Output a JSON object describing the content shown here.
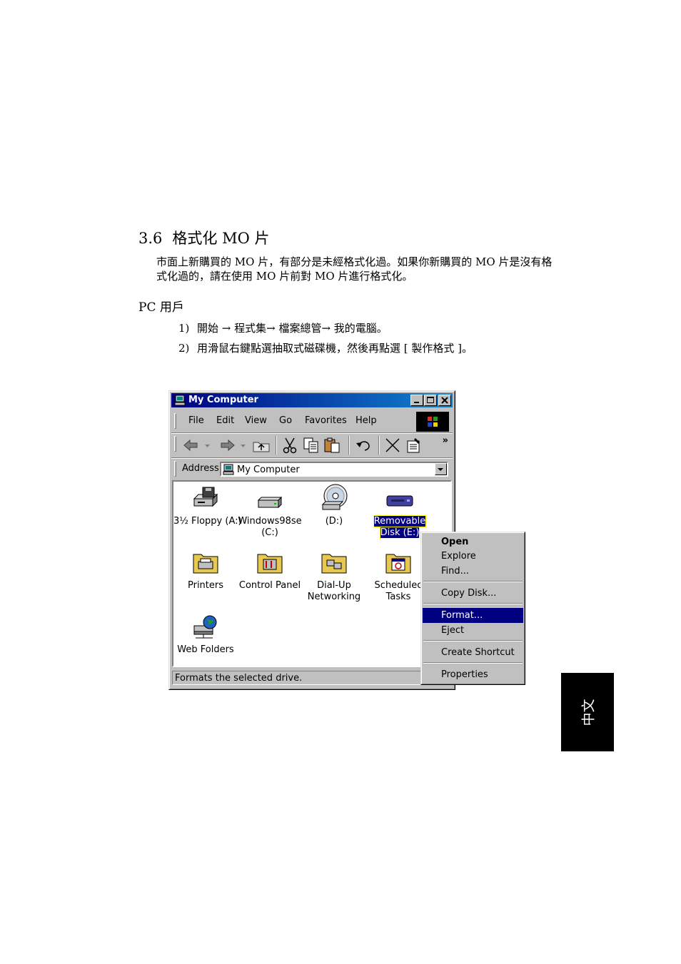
{
  "heading": {
    "number": "3.6",
    "title": "格式化 MO 片"
  },
  "intro": "市面上新購買的 MO 片，有部分是未經格式化過。如果你新購買的 MO 片是沒有格式化過的，請在使用 MO 片前對 MO 片進行格式化。",
  "subheading": "PC 用戶",
  "steps": [
    {
      "num": "1)",
      "text": "開始 → 程式集→ 檔案總管→ 我的電腦。"
    },
    {
      "num": "2)",
      "text": "用滑鼠右鍵點選抽取式磁碟機，然後再點選 [ 製作格式 ]。"
    }
  ],
  "side_tab": "中文",
  "window": {
    "title": "My Computer",
    "menu": [
      "File",
      "Edit",
      "View",
      "Go",
      "Favorites",
      "Help"
    ],
    "address_label": "Address",
    "address_value": "My Computer",
    "icons": [
      {
        "label": "3½ Floppy (A:)",
        "icon": "floppy-drive-icon"
      },
      {
        "label": "Windows98se",
        "label2": "(C:)",
        "icon": "hard-drive-icon"
      },
      {
        "label": "(D:)",
        "icon": "cd-drive-icon"
      },
      {
        "label": "Removable",
        "label2": "Disk (E:)",
        "icon": "removable-disk-icon",
        "selected": true
      },
      {
        "label": "Printers",
        "icon": "printers-folder-icon"
      },
      {
        "label": "Control Panel",
        "icon": "control-panel-folder-icon"
      },
      {
        "label": "Dial-Up",
        "label2": "Networking",
        "icon": "dialup-folder-icon"
      },
      {
        "label": "Schedulec",
        "label2": "Tasks",
        "icon": "scheduled-tasks-folder-icon"
      },
      {
        "label": "Web Folders",
        "icon": "web-folders-icon"
      }
    ],
    "status": "Formats the selected drive."
  },
  "context_menu": {
    "open": "Open",
    "explore": "Explore",
    "find": "Find...",
    "copy_disk": "Copy Disk...",
    "format": "Format...",
    "eject": "Eject",
    "create_shortcut": "Create Shortcut",
    "properties": "Properties"
  },
  "colors": {
    "titlebar": "#000080",
    "highlight": "#000080",
    "chrome": "#c0c0c0",
    "tab": "#000000"
  }
}
